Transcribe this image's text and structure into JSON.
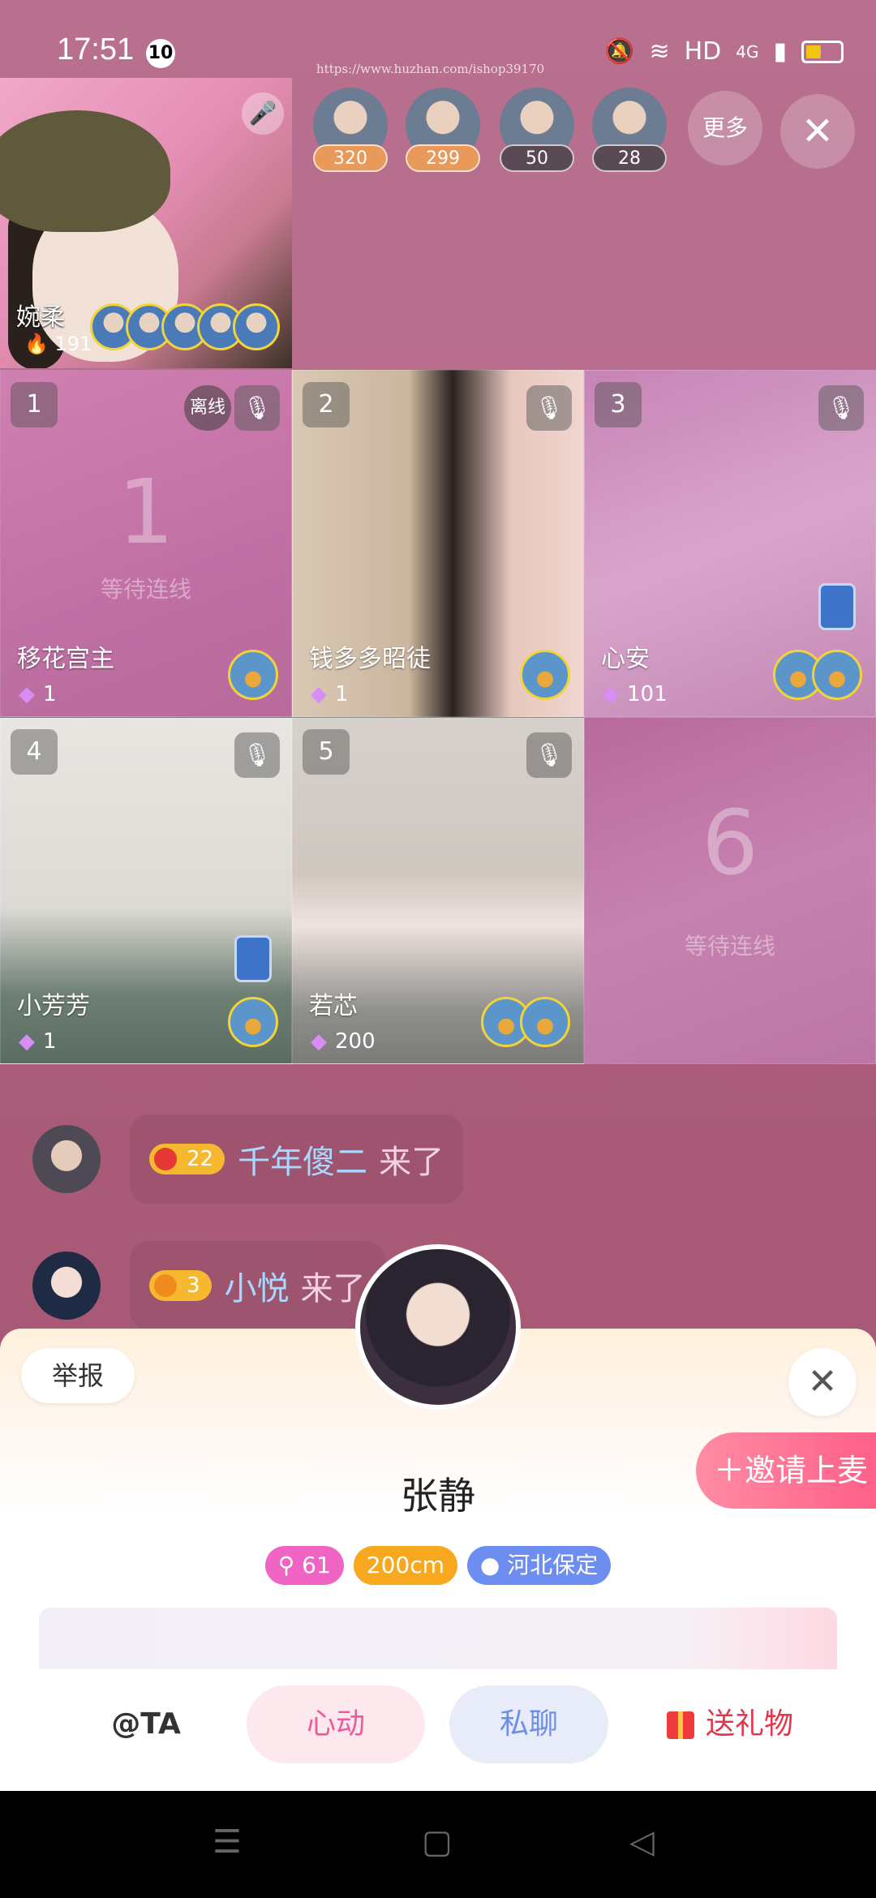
{
  "status_bar": {
    "time": "17:51",
    "notification_count": "10",
    "watermark": "https://www.huzhan.com/ishop39170",
    "network_label": "HD",
    "signal_label": "4G"
  },
  "room": {
    "more_label": "更多",
    "audience": [
      {
        "count": "320",
        "color": "#e99a5a"
      },
      {
        "count": "299",
        "color": "#e99a5a"
      },
      {
        "count": "50",
        "color": "#5a4a55"
      },
      {
        "count": "28",
        "color": "#5a4a55"
      }
    ]
  },
  "host": {
    "name": "婉柔",
    "hot": "191"
  },
  "seats": [
    {
      "number": "1",
      "name": "移花宫主",
      "score": "1",
      "status": "离线"
    },
    {
      "number": "2",
      "name": "钱多多昭徒",
      "score": "1"
    },
    {
      "number": "3",
      "name": "心安",
      "score": "101"
    },
    {
      "number": "4",
      "name": "小芳芳",
      "score": "1"
    },
    {
      "number": "5",
      "name": "若芯",
      "score": "200"
    }
  ],
  "wait_seats": [
    {
      "number": "1",
      "label": "等待连线"
    },
    {
      "number": "6",
      "label": "等待连线"
    }
  ],
  "chat": [
    {
      "level": "22",
      "name": "千年傻二",
      "action": "来了"
    },
    {
      "level": "3",
      "name": "小悦",
      "action": "来了"
    }
  ],
  "profile": {
    "report_label": "举报",
    "invite_label": "邀请上麦",
    "name": "张静",
    "tags": [
      "61",
      "200cm",
      "河北保定"
    ],
    "actions": {
      "at": "@TA",
      "heart": "心动",
      "chat": "私聊",
      "gift": "送礼物"
    }
  }
}
